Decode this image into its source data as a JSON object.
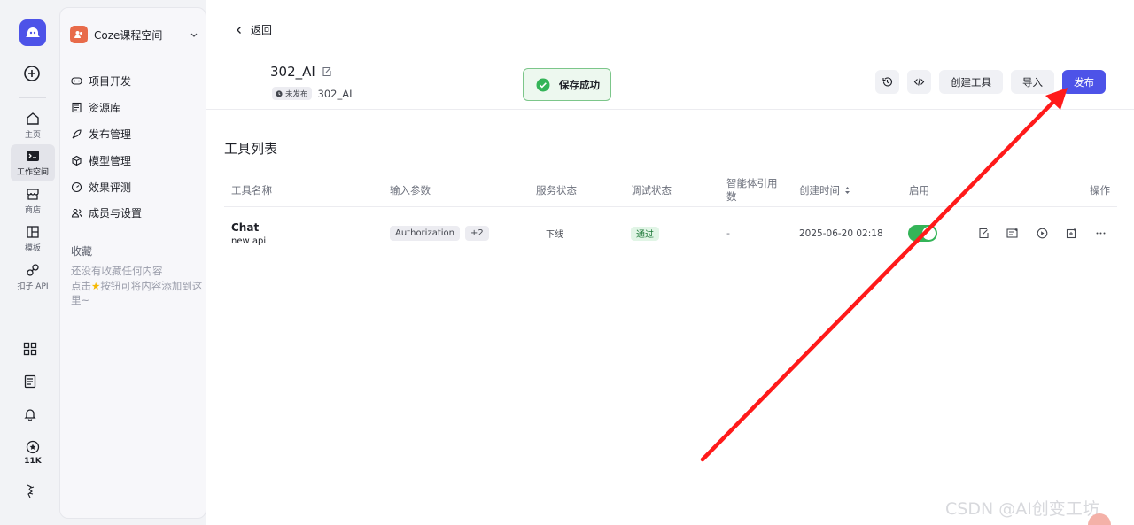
{
  "rail": {
    "items": [
      {
        "label": "主页",
        "icon": "home-icon"
      },
      {
        "label": "工作空间",
        "icon": "terminal-icon",
        "active": true
      },
      {
        "label": "商店",
        "icon": "store-icon"
      },
      {
        "label": "模板",
        "icon": "template-icon"
      },
      {
        "label": "扣子 API",
        "icon": "api-icon"
      }
    ],
    "stars": "11K"
  },
  "sidebar": {
    "workspace": "Coze课程空间",
    "nav": [
      {
        "label": "项目开发",
        "icon": "gamepad-icon"
      },
      {
        "label": "资源库",
        "icon": "library-icon"
      },
      {
        "label": "发布管理",
        "icon": "rocket-icon"
      },
      {
        "label": "模型管理",
        "icon": "cube-icon"
      },
      {
        "label": "效果评测",
        "icon": "gauge-icon"
      },
      {
        "label": "成员与设置",
        "icon": "members-icon"
      }
    ],
    "favorites_title": "收藏",
    "favorites_empty_1": "还没有收藏任何内容",
    "favorites_empty_2a": "点击",
    "favorites_empty_2b": "按钮可将内容添加到这里~"
  },
  "header": {
    "back": "返回",
    "title": "302_AI",
    "publish_badge": "未发布",
    "subtitle": "302_AI",
    "toast": "保存成功",
    "btn_create_tool": "创建工具",
    "btn_import": "导入",
    "btn_publish": "发布"
  },
  "section_title": "工具列表",
  "table": {
    "columns": [
      "工具名称",
      "输入参数",
      "服务状态",
      "调试状态",
      "智能体引用数",
      "创建时间",
      "启用",
      "操作"
    ],
    "rows": [
      {
        "name": "Chat",
        "desc": "new api",
        "param": "Authorization",
        "param_more": "+2",
        "service": "下线",
        "debug": "通过",
        "refs": "-",
        "created": "2025-06-20 02:18",
        "enabled": true
      }
    ]
  },
  "watermark": "CSDN @AI创变工坊",
  "colors": {
    "accent": "#4d53e8",
    "success": "#34b458",
    "arrow": "#ff1a1a"
  }
}
